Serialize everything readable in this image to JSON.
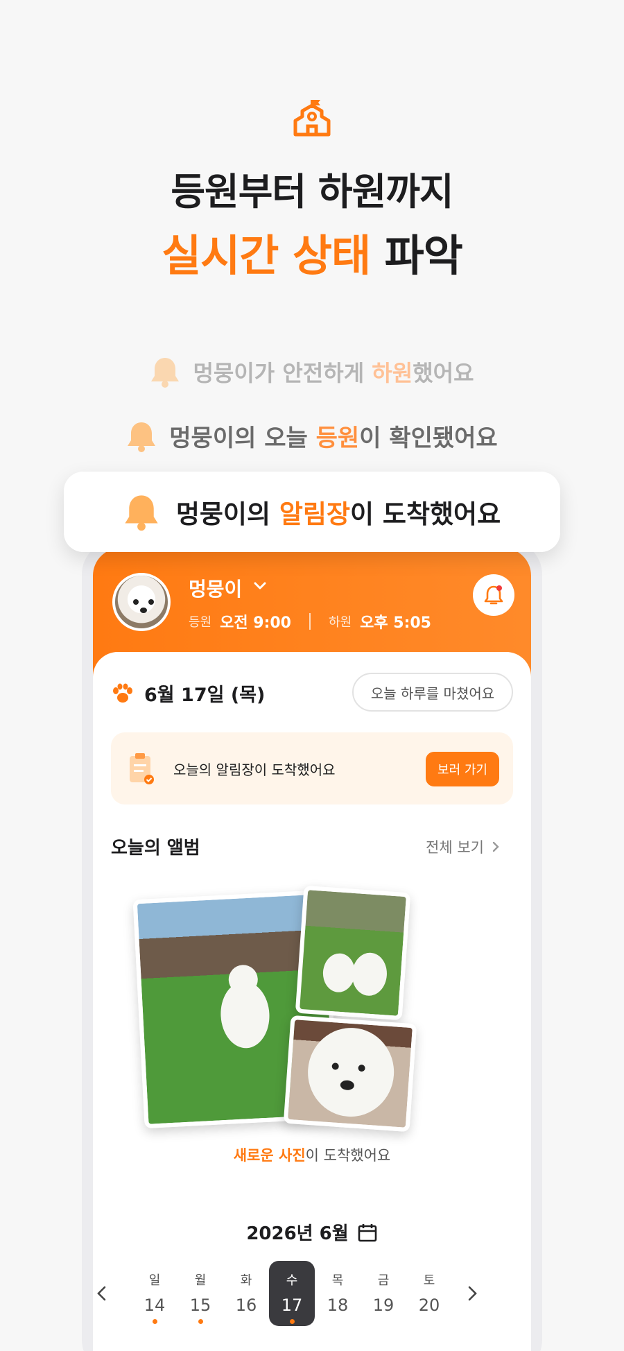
{
  "hero": {
    "line1": "등원부터 하원까지",
    "line2_accent": "실시간 상태",
    "line2_rest": " 파악"
  },
  "notifications": [
    {
      "pre": "멍뭉이가 안전하게 ",
      "hl": "하원",
      "post": "했어요"
    },
    {
      "pre": "멍뭉이의 오늘 ",
      "hl": "등원",
      "post": "이 확인됐어요"
    },
    {
      "pre": "멍뭉이의 ",
      "hl": "알림장",
      "post": "이 도착했어요"
    }
  ],
  "app": {
    "pet_name": "멍뭉이",
    "arrive_label": "등원",
    "arrive_time": "오전 9:00",
    "leave_label": "하원",
    "leave_time": "오후 5:05",
    "date": "6월 17일 (목)",
    "done_button": "오늘 하루를 마쳤어요",
    "notice_text": "오늘의 알림장이 도착했어요",
    "notice_button": "보러 가기",
    "album_title": "오늘의 앨범",
    "album_more": "전체 보기",
    "caption_hl": "새로운 사진",
    "caption_rest": "이 도착했어요",
    "calendar_title": "2026년 6월",
    "days": [
      {
        "wd": "일",
        "dn": "14",
        "dot": true
      },
      {
        "wd": "월",
        "dn": "15",
        "dot": true
      },
      {
        "wd": "화",
        "dn": "16",
        "dot": false
      },
      {
        "wd": "수",
        "dn": "17",
        "dot": true,
        "selected": true
      },
      {
        "wd": "목",
        "dn": "18",
        "dot": false
      },
      {
        "wd": "금",
        "dn": "19",
        "dot": false
      },
      {
        "wd": "토",
        "dn": "20",
        "dot": false
      }
    ]
  },
  "colors": {
    "accent": "#ff7a12",
    "selected_day": "#3a3a3e",
    "notice_bg": "#fff5ea"
  },
  "icons": [
    "school-icon",
    "bell-icon",
    "chevron-down-icon",
    "paw-icon",
    "clipboard-icon",
    "chevron-right-icon",
    "calendar-icon",
    "chevron-left-icon"
  ]
}
